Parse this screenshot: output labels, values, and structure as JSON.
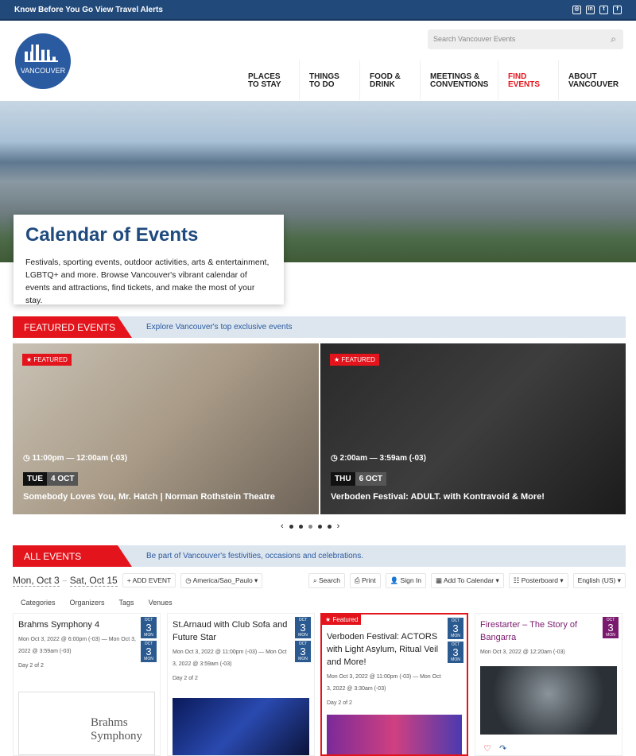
{
  "topbar": {
    "alert": "Know Before You Go View Travel Alerts",
    "social": [
      "instagram-icon",
      "linkedin-icon",
      "twitter-icon",
      "facebook-icon"
    ]
  },
  "logo": {
    "text": "VANCOUVER"
  },
  "search": {
    "placeholder": "Search Vancouver Events"
  },
  "nav": [
    {
      "label": "Places to stay"
    },
    {
      "label": "Things to do"
    },
    {
      "label": "Food & drink"
    },
    {
      "label": "Meetings & conventions"
    },
    {
      "label": "Find events",
      "active": true
    },
    {
      "label": "About Vancouver"
    }
  ],
  "hero": {
    "title": "Calendar of Events",
    "text": "Festivals, sporting events, outdoor activities, arts & entertainment, LGBTQ+ and more. Browse Vancouver's vibrant calendar of events and attractions, find tickets, and make the most of your stay."
  },
  "featured": {
    "tag": "FEATURED EVENTS",
    "sub": "Explore Vancouver's top exclusive events",
    "badge": "FEATURED",
    "items": [
      {
        "time": "11:00pm — 12:00am (-03)",
        "dow": "TUE",
        "date": "4 OCT",
        "title": "Somebody Loves You, Mr. Hatch | Norman Rothstein Theatre"
      },
      {
        "time": "2:00am — 3:59am (-03)",
        "dow": "THU",
        "date": "6 OCT",
        "title": "Verboden Festival: ADULT. with Kontravoid & More!"
      }
    ]
  },
  "all": {
    "tag": "ALL EVENTS",
    "sub": "Be part of Vancouver's festivities, occasions and celebrations."
  },
  "toolbar": {
    "from": "Mon, Oct 3",
    "to": "Sat, Oct 15",
    "add": "+ ADD EVENT",
    "tz": "America/Sao_Paulo ▾",
    "search": "Search",
    "print": "Print",
    "signin": "Sign In",
    "addcal": "Add To Calendar ▾",
    "view": "Posterboard ▾",
    "lang": "English (US) ▾"
  },
  "filters": [
    "Categories",
    "Organizers",
    "Tags",
    "Venues"
  ],
  "events": [
    {
      "title": "Brahms Symphony 4",
      "meta": "Mon Oct 3, 2022 @ 6:00pm (-03) — Mon Oct 3, 2022 @ 3:59am (-03)",
      "day": "Day 2 of 2",
      "cal": {
        "m": "OCT",
        "d": "3",
        "w": "MON"
      },
      "color": "#2a5a90"
    },
    {
      "title": "St.Arnaud with Club Sofa and Future Star",
      "meta": "Mon Oct 3, 2022 @ 11:00pm (-03) — Mon Oct 3, 2022 @ 3:59am (-03)",
      "day": "Day 2 of 2",
      "cal": {
        "m": "OCT",
        "d": "3",
        "w": "MON"
      },
      "color": "#2a5a90"
    },
    {
      "title": "Verboden Festival: ACTORS with Light Asylum, Ritual Veil and More!",
      "meta": "Mon Oct 3, 2022 @ 11:00pm (-03) — Mon Oct 3, 2022 @ 3:30am (-03)",
      "day": "Day 2 of 2",
      "badge": "★ Featured",
      "cal": {
        "m": "OCT",
        "d": "3",
        "w": "MON"
      },
      "color": "#2a5a90"
    },
    {
      "title": "Firestarter – The Story of Bangarra",
      "meta": "Mon Oct 3, 2022 @ 12:20am (-03)",
      "cal": {
        "m": "OCT",
        "d": "3",
        "w": "MON"
      },
      "color": "#7a1a6e"
    }
  ],
  "brahms_img": {
    "line1": "Brahms",
    "line2": "Symphony"
  },
  "colors": {
    "brand": "#21497a",
    "accent": "#e3141b"
  }
}
